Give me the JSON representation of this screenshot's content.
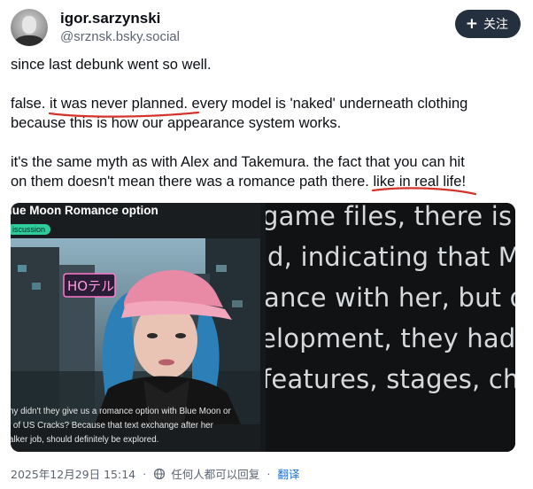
{
  "author": {
    "display_name": "igor.sarzynski",
    "handle": "@srznsk.bsky.social",
    "avatar_icon": "avatar-photo"
  },
  "follow_button": {
    "label": "关注",
    "icon": "plus-icon"
  },
  "post": {
    "line1": "since last debunk went so well.",
    "p2_prefix": "false. ",
    "p2_highlight": "it was never planned.",
    "p2_suffix_line1": " every model is 'naked' underneath clothing",
    "p2_line2": "because this is how our appearance system works.",
    "p3_line1": "it's the same myth as with Alex and Takemura. the fact that you can hit",
    "p3_line2_prefix": "on them doesn't mean there was a romance path there. ",
    "p3_highlight": "like in real life!",
    "highlight_color": "#d4332a"
  },
  "media": {
    "left": {
      "title": "lue Moon Romance option",
      "tag": "iscussion",
      "caption": [
        "hy didn't they give us a romance option with Blue Moon or",
        "l of US Cracks? Because that text exchange after her",
        "alker job, should definitely be explored."
      ],
      "sign_text": "HOテル"
    },
    "right": {
      "lines": [
        "game files, there is a",
        "d, indicating that MA",
        "ance with her, but du",
        "elopment, they had",
        " features, stages, ch"
      ]
    }
  },
  "footer": {
    "timestamp": "2025年12月29日 15:14",
    "reply_setting": "任何人都可以回复",
    "separator": "·",
    "translate": "翻译"
  }
}
